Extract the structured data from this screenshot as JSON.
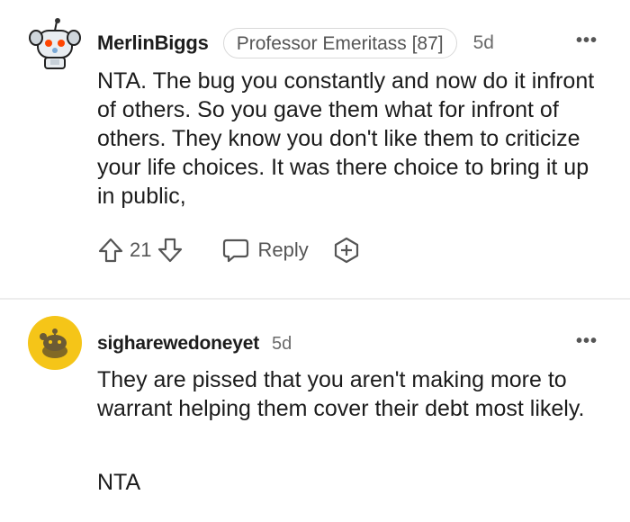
{
  "comments": [
    {
      "username": "MerlinBiggs",
      "flair": "Professor Emeritass [87]",
      "age": "5d",
      "more": "•••",
      "body": "NTA. The bug you constantly and now do it infront of others. So you gave them what for infront of others. They know you don't like them to criticize your life choices. It was there choice to bring it up in public,",
      "votes": "21",
      "reply_label": "Reply",
      "avatar": "robot-avatar-icon"
    },
    {
      "username": "sigharewedoneyet",
      "age": "5d",
      "more": "•••",
      "body": "They are pissed that you aren't making more to warrant helping them cover their debt most likely.",
      "body2": "NTA",
      "avatar": "snoo-avatar-icon"
    }
  ],
  "colors": {
    "text": "#1c1c1c",
    "meta": "#6a6a6a",
    "divider": "#ededed",
    "avatar2_bg": "#f5c518"
  }
}
